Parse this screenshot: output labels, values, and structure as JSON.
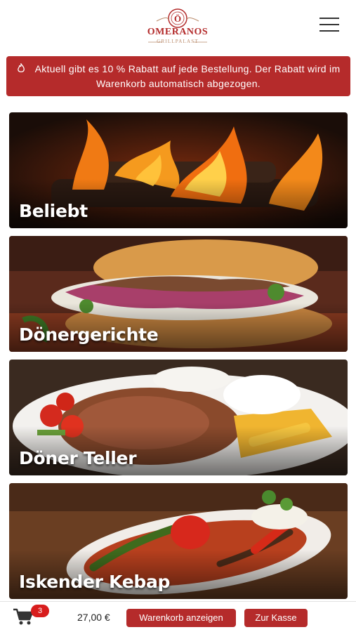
{
  "header": {
    "logo_name": "OMERANOS",
    "logo_sub": "GRILLPALAST",
    "menu_icon": "hamburger-menu-icon"
  },
  "promo": {
    "icon": "flame-icon",
    "text": "Aktuell gibt es 10 % Rabatt auf jede Bestellung. Der Rabatt wird im Warenkorb automatisch abgezogen."
  },
  "categories": [
    {
      "label": "Beliebt"
    },
    {
      "label": "Dönergerichte"
    },
    {
      "label": "Döner Teller"
    },
    {
      "label": "Iskender Kebap"
    }
  ],
  "footer": {
    "cart_icon": "shopping-cart-icon",
    "cart_count": "3",
    "total": "27,00 €",
    "show_cart_label": "Warenkorb anzeigen",
    "checkout_label": "Zur Kasse"
  },
  "colors": {
    "brand": "#b52b2b",
    "badge": "#d81d1d"
  }
}
